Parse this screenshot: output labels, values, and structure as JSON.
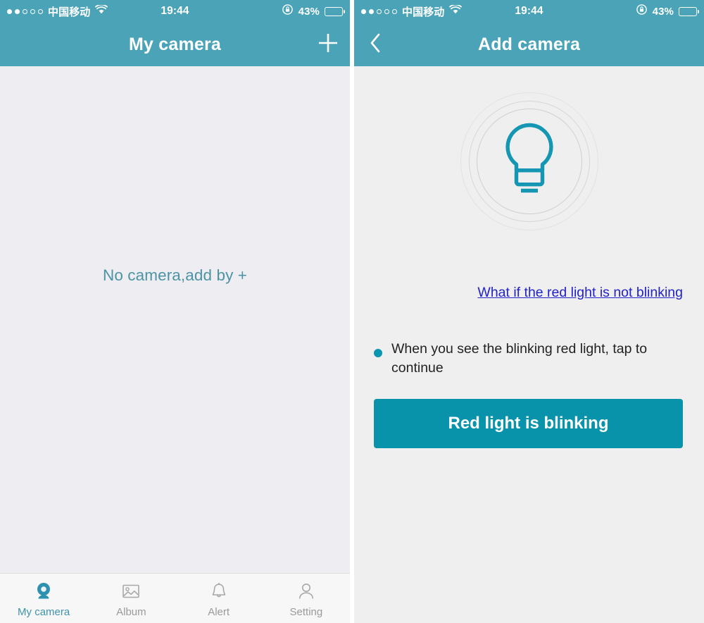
{
  "theme": {
    "header_bg": "#4ba3b8",
    "accent": "#0893ab",
    "page_bg": "#eeeef2",
    "link": "#2222cc",
    "muted_text": "#9a9a9a"
  },
  "status_bar": {
    "carrier": "中国移动",
    "signal_dots_filled": 2,
    "signal_dots_total": 5,
    "wifi_icon": "wifi-icon",
    "time": "19:44",
    "rotation_lock_icon": "rotation-lock-icon",
    "battery_percent": "43%",
    "battery_level": 43,
    "battery_icon": "battery-icon"
  },
  "left_screen": {
    "nav": {
      "title": "My camera",
      "add_icon": "plus-icon"
    },
    "empty_state": {
      "message": "No camera,add by +"
    },
    "tabs": [
      {
        "label": "My camera",
        "icon": "camera-icon",
        "active": true
      },
      {
        "label": "Album",
        "icon": "photo-icon",
        "active": false
      },
      {
        "label": "Alert",
        "icon": "bell-icon",
        "active": false
      },
      {
        "label": "Setting",
        "icon": "person-icon",
        "active": false
      }
    ]
  },
  "right_screen": {
    "nav": {
      "title": "Add camera",
      "back_icon": "chevron-left-icon"
    },
    "illustration": {
      "icon": "light-bulb-icon",
      "rings": 3
    },
    "help_link": "What if the red light is not blinking",
    "instruction": "When you see the blinking red light, tap to continue",
    "primary_button": "Red light is blinking"
  }
}
